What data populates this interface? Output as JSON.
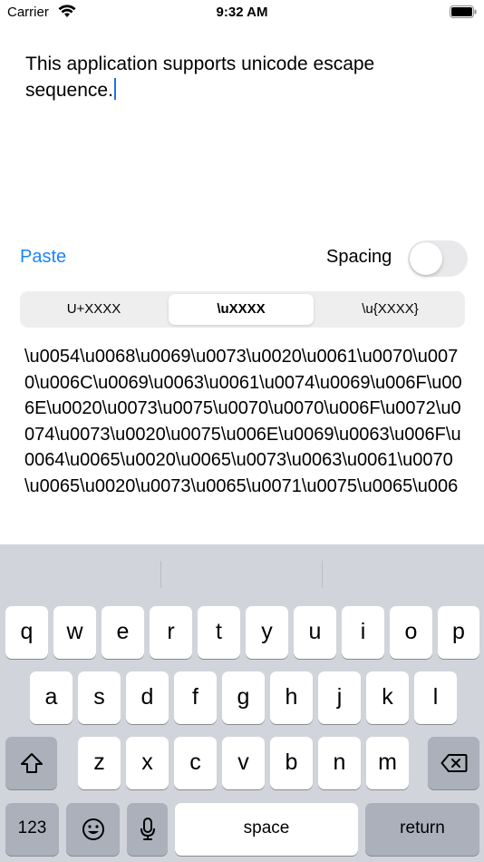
{
  "status": {
    "carrier": "Carrier",
    "time": "9:32 AM"
  },
  "editor": {
    "text": "This application supports unicode escape sequence."
  },
  "controls": {
    "paste_label": "Paste",
    "spacing_label": "Spacing",
    "spacing_on": false
  },
  "format": {
    "segments": [
      "U+XXXX",
      "\\uXXXX",
      "\\u{XXXX}"
    ],
    "selected": 1
  },
  "output": {
    "text": "\\u0054\\u0068\\u0069\\u0073\\u0020\\u0061\\u0070\\u0070\\u006C\\u0069\\u0063\\u0061\\u0074\\u0069\\u006F\\u006E\\u0020\\u0073\\u0075\\u0070\\u0070\\u006F\\u0072\\u0074\\u0073\\u0020\\u0075\\u006E\\u0069\\u0063\\u006F\\u0064\\u0065\\u0020\\u0065\\u0073\\u0063\\u0061\\u0070\\u0065\\u0020\\u0073\\u0065\\u0071\\u0075\\u0065\\u006"
  },
  "keyboard": {
    "row1": [
      "q",
      "w",
      "e",
      "r",
      "t",
      "y",
      "u",
      "i",
      "o",
      "p"
    ],
    "row2": [
      "a",
      "s",
      "d",
      "f",
      "g",
      "h",
      "j",
      "k",
      "l"
    ],
    "row3": [
      "z",
      "x",
      "c",
      "v",
      "b",
      "n",
      "m"
    ],
    "numbers_label": "123",
    "space_label": "space",
    "return_label": "return"
  }
}
